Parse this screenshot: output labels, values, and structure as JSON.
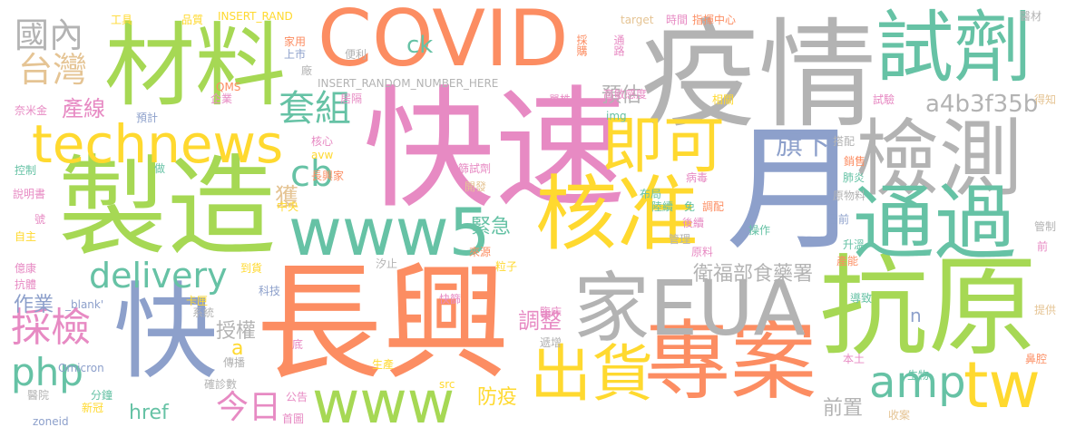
{
  "palette": {
    "orange": "#fc8d62",
    "pink": "#e78ac3",
    "green": "#a6d854",
    "teal": "#66c2a5",
    "blue": "#8da0cb",
    "yellow": "#ffd92f",
    "tan": "#e5c494",
    "gray": "#b3b3b3"
  },
  "words": [
    {
      "text": "長興",
      "color": "orange"
    },
    {
      "text": "快速",
      "color": "pink"
    },
    {
      "text": "疫情",
      "color": "gray"
    },
    {
      "text": "製造",
      "color": "green"
    },
    {
      "text": "COVID",
      "color": "orange"
    },
    {
      "text": "材料",
      "color": "green"
    },
    {
      "text": "試劑",
      "color": "teal"
    },
    {
      "text": "月",
      "color": "blue"
    },
    {
      "text": "抗原",
      "color": "green"
    },
    {
      "text": "專案",
      "color": "orange"
    },
    {
      "text": "家EUA",
      "color": "gray"
    },
    {
      "text": "快",
      "color": "blue"
    },
    {
      "text": "檢測",
      "color": "gray"
    },
    {
      "text": "通過",
      "color": "teal"
    },
    {
      "text": "technews",
      "color": "yellow"
    },
    {
      "text": "核准",
      "color": "yellow"
    },
    {
      "text": "即可",
      "color": "yellow"
    },
    {
      "text": "www5",
      "color": "teal"
    },
    {
      "text": "出貨",
      "color": "yellow"
    },
    {
      "text": "www",
      "color": "green"
    },
    {
      "text": "tw",
      "color": "yellow"
    },
    {
      "text": "amp",
      "color": "teal"
    },
    {
      "text": "php",
      "color": "teal"
    },
    {
      "text": "delivery",
      "color": "teal"
    },
    {
      "text": "採檢",
      "color": "pink"
    },
    {
      "text": "台灣",
      "color": "tan"
    },
    {
      "text": "國內",
      "color": "gray"
    },
    {
      "text": "套組",
      "color": "teal"
    },
    {
      "text": "cb",
      "color": "teal"
    },
    {
      "text": "旗下",
      "color": "blue"
    },
    {
      "text": "ck",
      "color": "teal"
    },
    {
      "text": "a4b3f35b",
      "color": "gray"
    },
    {
      "text": "衛福部食藥署",
      "color": "gray"
    },
    {
      "text": "今日",
      "color": "pink"
    },
    {
      "text": "緊急",
      "color": "teal"
    },
    {
      "text": "調整",
      "color": "pink"
    },
    {
      "text": "授權",
      "color": "gray"
    },
    {
      "text": "預估",
      "color": "gray"
    },
    {
      "text": "產線",
      "color": "pink"
    },
    {
      "text": "作業",
      "color": "blue"
    },
    {
      "text": "獲",
      "color": "tan"
    },
    {
      "text": "前置",
      "color": "gray"
    },
    {
      "text": "防疫",
      "color": "yellow"
    },
    {
      "text": "href",
      "color": "teal"
    },
    {
      "text": "a",
      "color": "yellow"
    },
    {
      "text": "n",
      "color": "blue"
    },
    {
      "text": "工具",
      "color": "yellow"
    },
    {
      "text": "品質",
      "color": "yellow"
    },
    {
      "text": "INSERT_RAND",
      "color": "yellow"
    },
    {
      "text": "target",
      "color": "tan"
    },
    {
      "text": "時間",
      "color": "pink"
    },
    {
      "text": "指揮中心",
      "color": "orange"
    },
    {
      "text": "醫材",
      "color": "gray"
    },
    {
      "text": "家用",
      "color": "orange"
    },
    {
      "text": "上市",
      "color": "blue"
    },
    {
      "text": "採購",
      "color": "orange"
    },
    {
      "text": "通路",
      "color": "pink"
    },
    {
      "text": "便利",
      "color": "gray"
    },
    {
      "text": "廠",
      "color": "gray"
    },
    {
      "text": "INSERT_RANDOM_NUMBER_HERE",
      "color": "gray"
    },
    {
      "text": "高敏感度",
      "color": "pink"
    },
    {
      "text": "居隔",
      "color": "pink"
    },
    {
      "text": "QMS",
      "color": "orange"
    },
    {
      "text": "企業",
      "color": "pink"
    },
    {
      "text": "單株",
      "color": "pink"
    },
    {
      "text": "相關",
      "color": "yellow"
    },
    {
      "text": "試驗",
      "color": "pink"
    },
    {
      "text": "得知",
      "color": "tan"
    },
    {
      "text": "奈米金",
      "color": "pink"
    },
    {
      "text": "預計",
      "color": "blue"
    },
    {
      "text": "img",
      "color": "teal"
    },
    {
      "text": "核心",
      "color": "pink"
    },
    {
      "text": "搭配",
      "color": "gray"
    },
    {
      "text": "控制",
      "color": "teal"
    },
    {
      "text": "做",
      "color": "teal"
    },
    {
      "text": "avw",
      "color": "yellow"
    },
    {
      "text": "篩試劑",
      "color": "pink"
    },
    {
      "text": "病毒",
      "color": "pink"
    },
    {
      "text": "銷售",
      "color": "orange"
    },
    {
      "text": "說明書",
      "color": "pink"
    },
    {
      "text": "長興家",
      "color": "orange"
    },
    {
      "text": "布局",
      "color": "teal"
    },
    {
      "text": "肺炎",
      "color": "teal"
    },
    {
      "text": "原物料",
      "color": "gray"
    },
    {
      "text": "號",
      "color": "pink"
    },
    {
      "text": "中央",
      "color": "yellow"
    },
    {
      "text": "開發",
      "color": "tan"
    },
    {
      "text": "陸續",
      "color": "teal"
    },
    {
      "text": "免",
      "color": "teal"
    },
    {
      "text": "調配",
      "color": "orange"
    },
    {
      "text": "日前",
      "color": "blue"
    },
    {
      "text": "自主",
      "color": "yellow"
    },
    {
      "text": "後續",
      "color": "pink"
    },
    {
      "text": "管理",
      "color": "gray"
    },
    {
      "text": "操作",
      "color": "teal"
    },
    {
      "text": "管制",
      "color": "gray"
    },
    {
      "text": "億康",
      "color": "pink"
    },
    {
      "text": "來源",
      "color": "orange"
    },
    {
      "text": "原料",
      "color": "pink"
    },
    {
      "text": "粒子",
      "color": "yellow"
    },
    {
      "text": "升溫",
      "color": "teal"
    },
    {
      "text": "前",
      "color": "pink"
    },
    {
      "text": "抗體",
      "color": "pink"
    },
    {
      "text": "到貨",
      "color": "yellow"
    },
    {
      "text": "汐止",
      "color": "gray"
    },
    {
      "text": "產能",
      "color": "orange"
    },
    {
      "text": "_blank'",
      "color": "blue"
    },
    {
      "text": "科技",
      "color": "blue"
    },
    {
      "text": "卡匣",
      "color": "yellow"
    },
    {
      "text": "系統",
      "color": "gray"
    },
    {
      "text": "快篩",
      "color": "pink"
    },
    {
      "text": "臨床",
      "color": "pink"
    },
    {
      "text": "導致",
      "color": "teal"
    },
    {
      "text": "提供",
      "color": "tan"
    },
    {
      "text": "傳播",
      "color": "gray"
    },
    {
      "text": "底",
      "color": "pink"
    },
    {
      "text": "遞增",
      "color": "gray"
    },
    {
      "text": "Omicron",
      "color": "blue"
    },
    {
      "text": "生產",
      "color": "yellow"
    },
    {
      "text": "本土",
      "color": "pink"
    },
    {
      "text": "鼻腔",
      "color": "orange"
    },
    {
      "text": "確診數",
      "color": "gray"
    },
    {
      "text": "生物",
      "color": "teal"
    },
    {
      "text": "醫院",
      "color": "gray"
    },
    {
      "text": "分鐘",
      "color": "teal"
    },
    {
      "text": "src",
      "color": "yellow"
    },
    {
      "text": "新冠",
      "color": "yellow"
    },
    {
      "text": "公告",
      "color": "pink"
    },
    {
      "text": "zoneid",
      "color": "blue"
    },
    {
      "text": "首圖",
      "color": "pink"
    },
    {
      "text": "收案",
      "color": "tan"
    }
  ]
}
